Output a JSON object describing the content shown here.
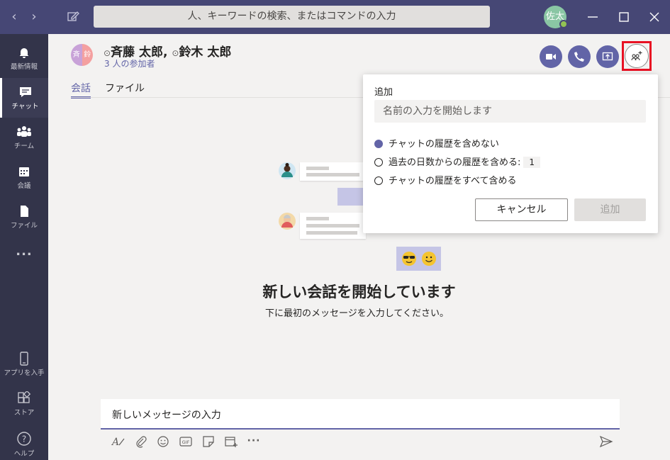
{
  "search": {
    "placeholder": "人、キーワードの検索、またはコマンドの入力"
  },
  "user": {
    "initials": "佐太"
  },
  "rail": [
    {
      "label": "最新情報"
    },
    {
      "label": "チャット"
    },
    {
      "label": "チーム"
    },
    {
      "label": "会議"
    },
    {
      "label": "ファイル"
    },
    {
      "label": "..."
    },
    {
      "label": "アプリを入手"
    },
    {
      "label": "ストア"
    },
    {
      "label": "ヘルプ"
    }
  ],
  "chat": {
    "avatar_left": "斉",
    "avatar_right": "鈴",
    "member1": "斉藤 太郎,",
    "member2": "鈴木 太郎",
    "participants": "3 人の参加者",
    "tabs": [
      "会話",
      "ファイル"
    ]
  },
  "empty": {
    "title": "新しい会話を開始しています",
    "subtitle": "下に最初のメッセージを入力してください。"
  },
  "composer": {
    "placeholder": "新しいメッセージの入力"
  },
  "add_popup": {
    "title": "追加",
    "input_placeholder": "名前の入力を開始します",
    "options": [
      {
        "label": "チャットの履歴を含めない",
        "selected": true
      },
      {
        "label": "過去の日数からの履歴を含める:",
        "value": "1",
        "selected": false
      },
      {
        "label": "チャットの履歴をすべて含める",
        "selected": false
      }
    ],
    "cancel": "キャンセル",
    "add": "追加"
  },
  "colors": {
    "brand": "#6264a7",
    "titlebar": "#464775",
    "rail": "#33344a",
    "highlight": "#e81123"
  }
}
